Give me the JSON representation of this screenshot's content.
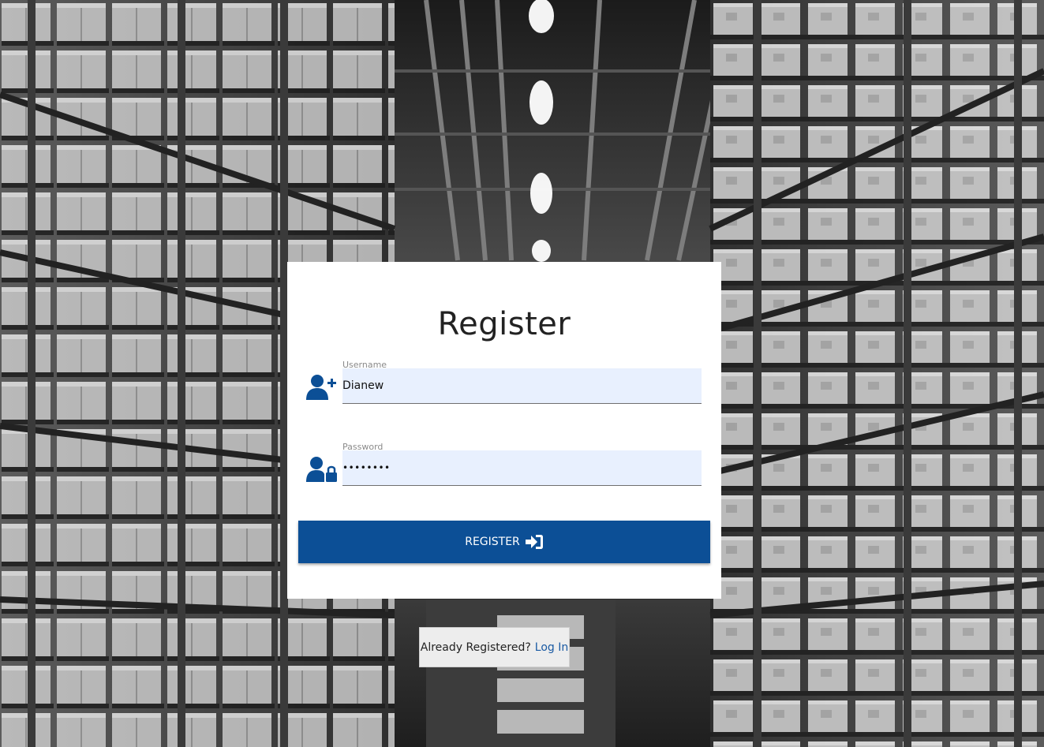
{
  "page": {
    "title": "Register"
  },
  "form": {
    "username": {
      "label": "Username",
      "value": "Dianew",
      "icon": "user-plus-icon"
    },
    "password": {
      "label": "Password",
      "value": "••••••••",
      "icon": "user-lock-icon"
    },
    "submit": {
      "label": "REGISTER",
      "icon": "sign-in-icon"
    }
  },
  "footer": {
    "prompt": "Already Registered?",
    "link_label": "Log In"
  },
  "colors": {
    "primary": "#0c4f96",
    "input_bg": "#e8f0fe",
    "card_bg": "#ffffff",
    "link": "#1a5aa3"
  }
}
